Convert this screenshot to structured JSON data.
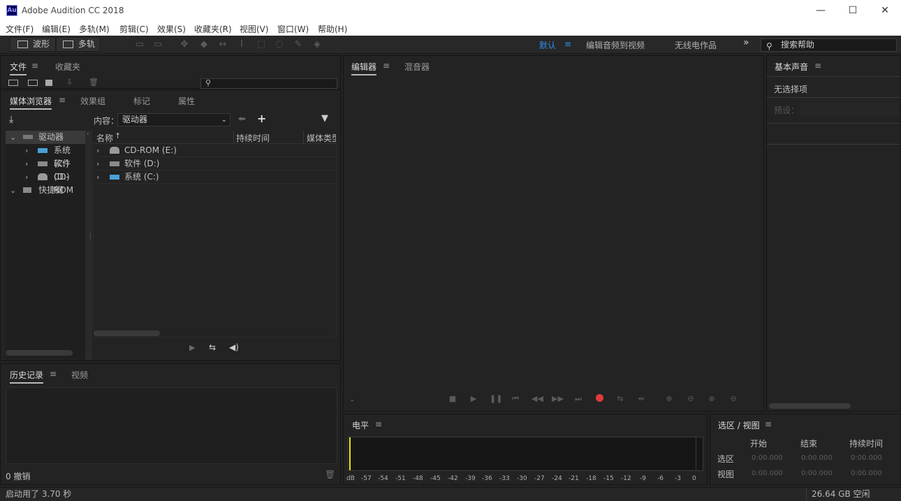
{
  "window": {
    "title": "Adobe Audition CC 2018",
    "logo": "Au",
    "minimize": "—",
    "maximize": "☐",
    "close": "✕"
  },
  "menu": [
    "文件(F)",
    "编辑(E)",
    "多轨(M)",
    "剪辑(C)",
    "效果(S)",
    "收藏夹(R)",
    "视图(V)",
    "窗口(W)",
    "帮助(H)"
  ],
  "toolbar": {
    "waveform": "波形",
    "multitrack": "多轨",
    "workspaces": [
      "默认",
      "编辑音频到视频",
      "无线电作品"
    ],
    "more": "»",
    "search_placeholder": "搜索帮助"
  },
  "files_panel": {
    "tabs": [
      "文件",
      "收藏夹"
    ]
  },
  "media_panel": {
    "tabs": [
      "媒体浏览器",
      "效果组",
      "标记",
      "属性"
    ],
    "content_label": "内容：",
    "content_value": "驱动器",
    "tree": [
      {
        "label": "驱动器",
        "icon": "drive-group-icon"
      },
      {
        "label": "系统 (C:)",
        "icon": "system-drive-icon"
      },
      {
        "label": "软件 (D:)",
        "icon": "hard-drive-icon"
      },
      {
        "label": "CD-ROM",
        "icon": "cdrom-icon"
      },
      {
        "label": "快捷键",
        "icon": "shortcut-icon"
      }
    ],
    "columns": [
      "名称",
      "持续时间",
      "媒体类型"
    ],
    "rows": [
      {
        "label": "CD-ROM (E:)",
        "icon": "cdrom-icon"
      },
      {
        "label": "软件 (D:)",
        "icon": "hard-drive-icon"
      },
      {
        "label": "系统 (C:)",
        "icon": "system-drive-icon"
      }
    ]
  },
  "history_panel": {
    "tabs": [
      "历史记录",
      "视频"
    ],
    "undo_count": "0 撤销"
  },
  "editor_panel": {
    "tabs": [
      "编辑器",
      "混音器"
    ],
    "time": "-"
  },
  "level_panel": {
    "title": "电平",
    "scale": [
      "dB",
      "-57",
      "-54",
      "-51",
      "-48",
      "-45",
      "-42",
      "-39",
      "-36",
      "-33",
      "-30",
      "-27",
      "-24",
      "-21",
      "-18",
      "-15",
      "-12",
      "-9",
      "-6",
      "-3",
      "0"
    ]
  },
  "selection_panel": {
    "title": "选区 / 视图",
    "columns": [
      "开始",
      "结束",
      "持续时间"
    ],
    "rows": [
      {
        "label": "选区",
        "values": [
          "0:00.000",
          "0:00.000",
          "0:00.000"
        ]
      },
      {
        "label": "视图",
        "values": [
          "0:00.000",
          "0:00.000",
          "0:00.000"
        ]
      }
    ]
  },
  "essential_panel": {
    "title": "基本声音",
    "no_selection": "无选择项",
    "preset_label": "预设："
  },
  "status": {
    "startup": "启动用了 3.70 秒",
    "disk": "26.64 GB 空闲"
  },
  "colors": {
    "accent": "#2d8ceb",
    "record": "#e03b3b",
    "meter_marker": "#e8e800"
  }
}
